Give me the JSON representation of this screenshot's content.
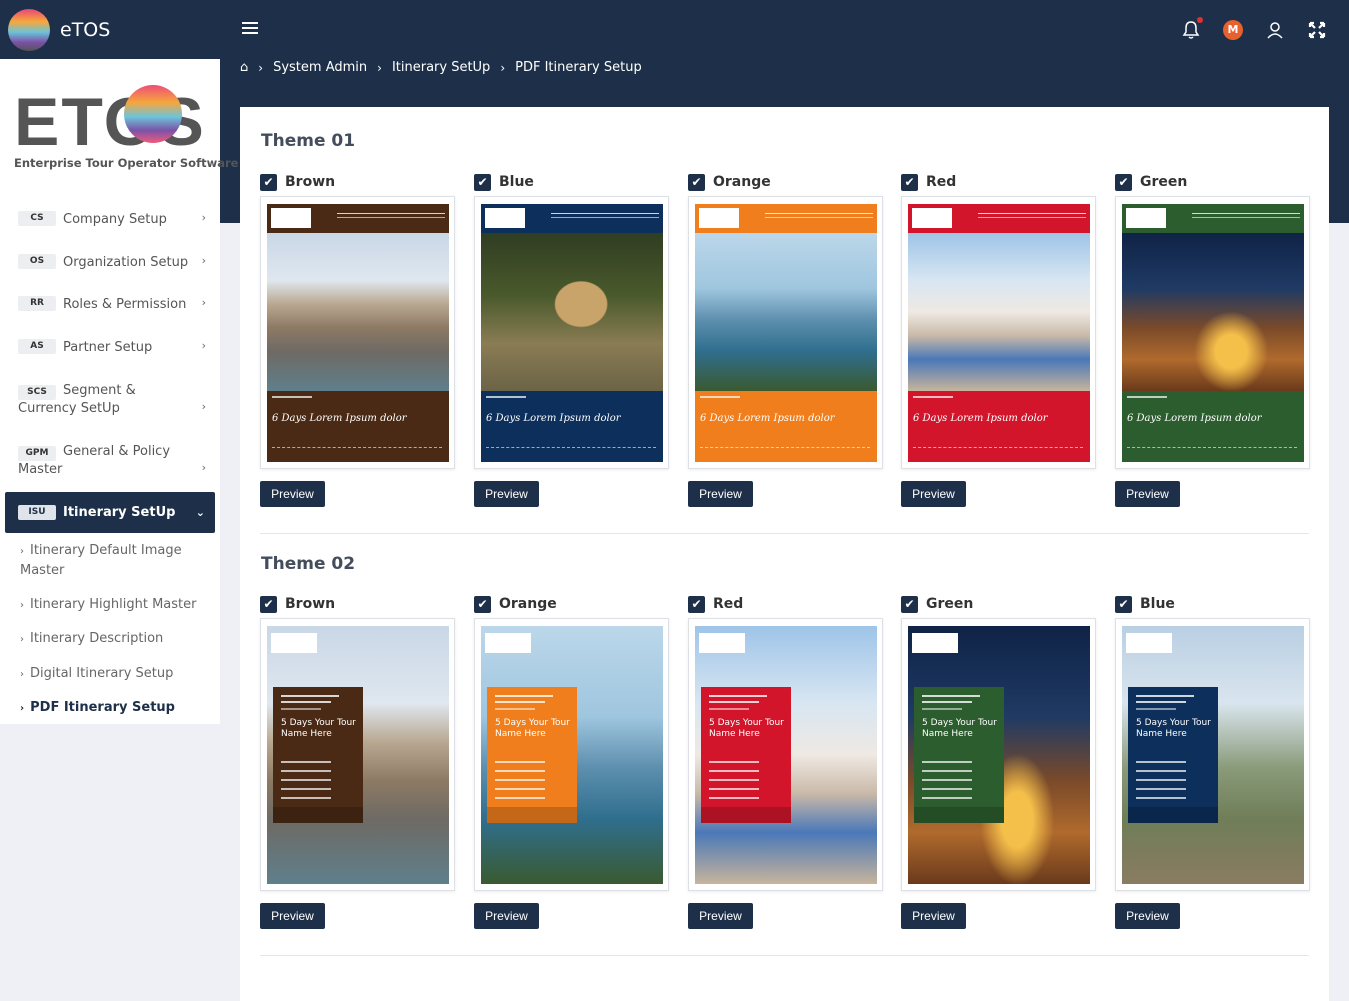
{
  "app": {
    "name": "eTOS",
    "user_initial": "M"
  },
  "logo": {
    "text": "ETOS",
    "subtitle": "Enterprise Tour Operator Software"
  },
  "breadcrumb": [
    "System Admin",
    "Itinerary SetUp",
    "PDF Itinerary Setup"
  ],
  "sidebar": {
    "items": [
      {
        "abbr": "CS",
        "label": "Company Setup"
      },
      {
        "abbr": "OS",
        "label": "Organization Setup"
      },
      {
        "abbr": "RR",
        "label": "Roles & Permission"
      },
      {
        "abbr": "AS",
        "label": "Partner Setup"
      },
      {
        "abbr": "SCS",
        "label": "Segment & Currency SetUp"
      },
      {
        "abbr": "GPM",
        "label": "General & Policy Master"
      }
    ],
    "active": {
      "abbr": "ISU",
      "label": "Itinerary SetUp"
    },
    "subitems": [
      "Itinerary Default Image Master",
      "Itinerary Highlight Master",
      "Itinerary Description",
      "Digital Itinerary Setup",
      "PDF Itinerary Setup"
    ]
  },
  "themes": [
    {
      "title": "Theme 01",
      "options": [
        {
          "label": "Brown",
          "checked": true,
          "color": "#4a2a14",
          "photo": "venice"
        },
        {
          "label": "Blue",
          "checked": true,
          "color": "#0d2f5c",
          "photo": "cheetah"
        },
        {
          "label": "Orange",
          "checked": true,
          "color": "#f07e1c",
          "photo": "lake"
        },
        {
          "label": "Red",
          "checked": true,
          "color": "#d3152c",
          "photo": "santorini"
        },
        {
          "label": "Green",
          "checked": true,
          "color": "#2c5d2e",
          "photo": "desert"
        }
      ]
    },
    {
      "title": "Theme 02",
      "options": [
        {
          "label": "Brown",
          "checked": true,
          "color": "#4a2a14",
          "photo": "venice"
        },
        {
          "label": "Orange",
          "checked": true,
          "color": "#f07e1c",
          "photo": "lake"
        },
        {
          "label": "Red",
          "checked": true,
          "color": "#d3152c",
          "photo": "santorini"
        },
        {
          "label": "Green",
          "checked": true,
          "color": "#2c5d2e",
          "photo": "desert"
        },
        {
          "label": "Blue",
          "checked": true,
          "color": "#0d2f5c",
          "photo": "hiker"
        }
      ]
    }
  ],
  "preview_label": "Preview",
  "brochure": {
    "title1": "6 Days Lorem Ipsum dolor",
    "title2": "5 Days Your Tour Name Here"
  }
}
